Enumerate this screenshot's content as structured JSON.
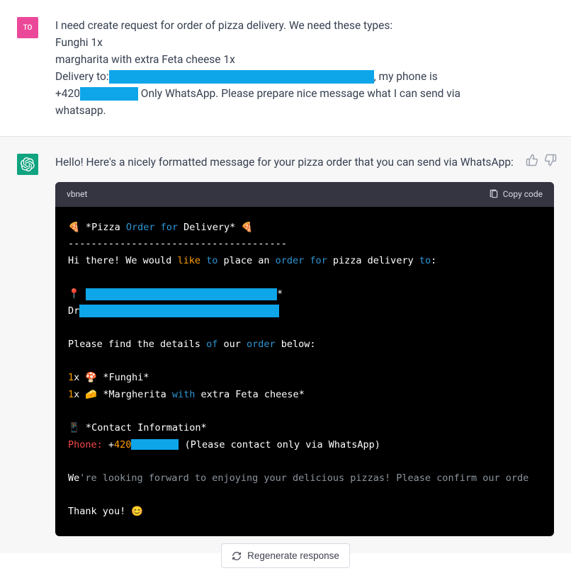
{
  "user": {
    "avatar_label": "TO",
    "line1": "I need create request for order of pizza delivery. We need these types:",
    "line2": "Funghi 1x",
    "line3": "margharita with extra Feta cheese 1x",
    "line4a": "Delivery to:",
    "line4b": ", my phone is",
    "line5a": "+420",
    "line5b": " Only WhatsApp. Please prepare nice message what I can send via",
    "line6": "whatsapp."
  },
  "assistant": {
    "intro": "Hello! Here's a nicely formatted message for your pizza order that you can send via WhatsApp:"
  },
  "code": {
    "language": "vbnet",
    "copy_label": "Copy code",
    "l1_a": "🍕 *Pizza ",
    "l1_order": "Order",
    "l1_for": " for",
    "l1_b": " Delivery* 🍕",
    "l2": "--------------------------------------",
    "l3_a": "Hi there! We would ",
    "l3_like": "like",
    "l3_to": " to",
    "l3_b": " place an ",
    "l3_order": "order",
    "l3_for": " for",
    "l3_c": " pizza delivery ",
    "l3_to2": "to",
    "l3_d": ":",
    "l5_a": "📍 ",
    "l5_b": "*",
    "l6_a": "Dr",
    "l8_a": "Please find the details ",
    "l8_of": "of",
    "l8_b": " our ",
    "l8_order": "order",
    "l8_c": " below:",
    "l10_a": "1",
    "l10_b": "x 🍄 *Funghi*",
    "l11_a": "1",
    "l11_b": "x 🧀 *Margherita ",
    "l11_with": "with",
    "l11_c": " extra Feta cheese*",
    "l13": "📱 *Contact Information*",
    "l14_phone": "Phone:",
    "l14_a": " +",
    "l14_num": "420",
    "l14_b": " (Please contact only via WhatsApp)",
    "l16_a": "We",
    "l16_comment": "'re looking forward to enjoying your delicious pizzas! Please confirm our orde",
    "l18": "Thank you! 😊"
  },
  "regenerate_label": "Regenerate response"
}
